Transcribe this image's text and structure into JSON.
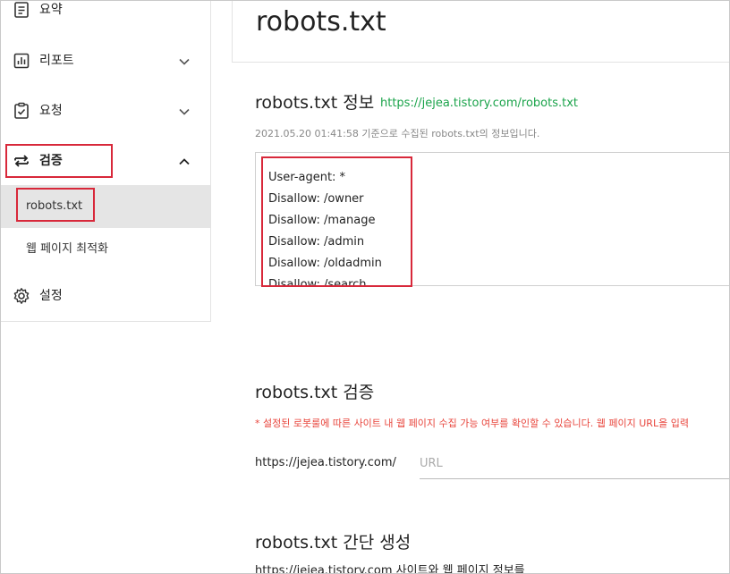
{
  "sidebar": {
    "items": [
      {
        "label": "요약"
      },
      {
        "label": "리포트"
      },
      {
        "label": "요청"
      },
      {
        "label": "검증"
      },
      {
        "label": "설정"
      }
    ],
    "sub_items": [
      {
        "label": "robots.txt"
      },
      {
        "label": "웹 페이지 최적화"
      }
    ]
  },
  "main": {
    "title": "robots.txt",
    "info_section": {
      "title": "robots.txt 정보",
      "url": "https://jejea.tistory.com/robots.txt",
      "collected_text": "2021.05.20 01:41:58 기준으로 수집된 robots.txt의 정보입니다.",
      "lines": [
        "User-agent: *",
        "Disallow: /owner",
        "Disallow: /manage",
        "Disallow: /admin",
        "Disallow: /oldadmin",
        "Disallow: /search"
      ]
    },
    "verify_section": {
      "title": "robots.txt 검증",
      "notice": "* 설정된 로봇룰에 따른 사이트 내 웹 페이지 수집 가능 여부를 확인할 수 있습니다. 웹 페이지 URL을 입력",
      "base_url": "https://jejea.tistory.com/",
      "input_placeholder": "URL",
      "input_value": ""
    },
    "generate_section": {
      "title": "robots.txt 간단 생성",
      "description": "https://jejea.tistory.com 사이트와 웹 페이지 정보를"
    }
  },
  "colors": {
    "highlight": "#d8283a",
    "link": "#1aa34a",
    "notice": "#e8453c"
  }
}
